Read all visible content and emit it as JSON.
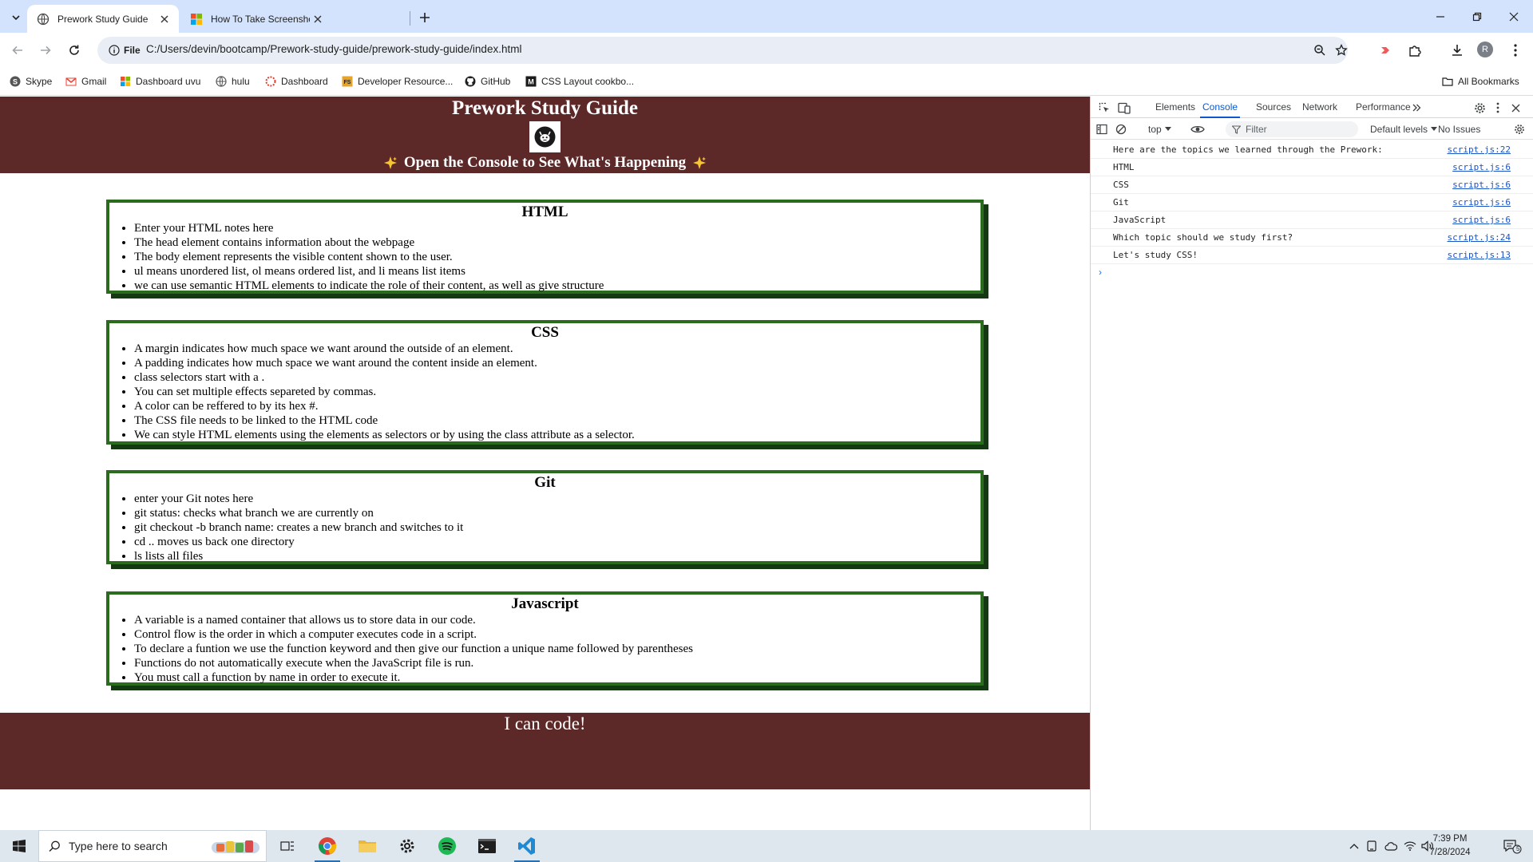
{
  "browser": {
    "tabs": [
      {
        "title": "Prework Study Guide",
        "active": true,
        "icon": "globe-icon"
      },
      {
        "title": "How To Take Screenshot On W",
        "active": false,
        "icon": "windows-logo-icon"
      }
    ],
    "address": {
      "chip_label": "File",
      "url": "C:/Users/devin/bootcamp/Prework-study-guide/prework-study-guide/index.html"
    },
    "profile_initial": "R",
    "bookmarks": [
      {
        "label": "Skype",
        "icon": "skype-icon"
      },
      {
        "label": "Gmail",
        "icon": "gmail-icon"
      },
      {
        "label": "Dashboard uvu",
        "icon": "ms-logo-icon"
      },
      {
        "label": "hulu",
        "icon": "globe-icon"
      },
      {
        "label": "Dashboard",
        "icon": "canvas-icon"
      },
      {
        "label": "Developer Resource...",
        "icon": "fs-icon"
      },
      {
        "label": "GitHub",
        "icon": "github-icon"
      },
      {
        "label": "CSS Layout cookbo...",
        "icon": "mdn-icon"
      }
    ],
    "all_bookmarks_label": "All Bookmarks"
  },
  "page": {
    "title": "Prework Study Guide",
    "subtitle": "Open the Console to See What's Happening",
    "sections": [
      {
        "heading": "HTML",
        "items": [
          "Enter your HTML notes here",
          "The head element contains information about the webpage",
          "The body element represents the visible content shown to the user.",
          "ul means unordered list, ol means ordered list, and li means list items",
          "we can use semantic HTML elements to indicate the role of their content, as well as give structure"
        ]
      },
      {
        "heading": "CSS",
        "items": [
          "A margin indicates how much space we want around the outside of an element.",
          "A padding indicates how much space we want around the content inside an element.",
          "class selectors start with a .",
          "You can set multiple effects separeted by commas.",
          "A color can be reffered to by its hex #.",
          "The CSS file needs to be linked to the HTML code",
          "We can style HTML elements using the elements as selectors or by using the class attribute as a selector."
        ]
      },
      {
        "heading": "Git",
        "items": [
          "enter your Git notes here",
          "git status: checks what branch we are currently on",
          "git checkout -b branch name: creates a new branch and switches to it",
          "cd .. moves us back one directory",
          "ls lists all files"
        ]
      },
      {
        "heading": "Javascript",
        "items": [
          "A variable is a named container that allows us to store data in our code.",
          "Control flow is the order in which a computer executes code in a script.",
          "To declare a funtion we use the function keyword and then give our function a unique name followed by parentheses",
          "Functions do not automatically execute when the JavaScript file is run.",
          "You must call a function by name in order to execute it."
        ]
      }
    ],
    "footer": "I can code!"
  },
  "devtools": {
    "tabs": [
      "Elements",
      "Console",
      "Sources",
      "Network",
      "Performance"
    ],
    "active_tab": "Console",
    "context": "top",
    "filter_placeholder": "Filter",
    "levels": "Default levels",
    "issues": "No Issues",
    "logs": [
      {
        "message": "Here are the topics we learned through the Prework:",
        "source": "script.js:22"
      },
      {
        "message": "HTML",
        "source": "script.js:6"
      },
      {
        "message": "CSS",
        "source": "script.js:6"
      },
      {
        "message": "Git",
        "source": "script.js:6"
      },
      {
        "message": "JavaScript",
        "source": "script.js:6"
      },
      {
        "message": "Which topic should we study first?",
        "source": "script.js:24"
      },
      {
        "message": "Let's study CSS!",
        "source": "script.js:13"
      }
    ],
    "prompt_symbol": "›"
  },
  "taskbar": {
    "search_placeholder": "Type here to search",
    "time": "7:39 PM",
    "date": "7/28/2024",
    "notification_count": "5"
  },
  "colors": {
    "brand_maroon": "#5c2828",
    "section_border": "#2a6b1e",
    "chrome_accent": "#0b57d0"
  }
}
